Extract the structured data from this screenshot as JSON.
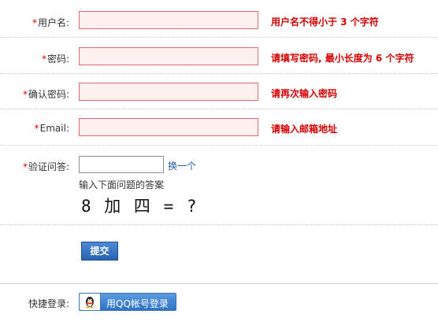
{
  "form": {
    "required_mark": "*",
    "username": {
      "label": "用户名:",
      "value": "",
      "error": "用户名不得小于 3 个字符"
    },
    "password": {
      "label": "密码:",
      "value": "",
      "error": "请填写密码, 最小长度为 6 个字符"
    },
    "confirm_password": {
      "label": "确认密码:",
      "value": "",
      "error": "请再次输入密码"
    },
    "email": {
      "label": "Email:",
      "value": "",
      "error": "请输入邮箱地址"
    },
    "captcha": {
      "label": "验证问答:",
      "value": "",
      "refresh_link": "换一个",
      "hint": "输入下面问题的答案",
      "question": "8 加 四 = ?"
    },
    "submit_label": "提交"
  },
  "quick_login": {
    "label": "快捷登录:",
    "qq_button_label": "用QQ帐号登录"
  },
  "colors": {
    "error_text": "#d40000",
    "invalid_input_bg": "#fff0f0",
    "invalid_input_border": "#e36a6a",
    "link": "#1f5da8",
    "button_blue": "#2f6fc1"
  }
}
